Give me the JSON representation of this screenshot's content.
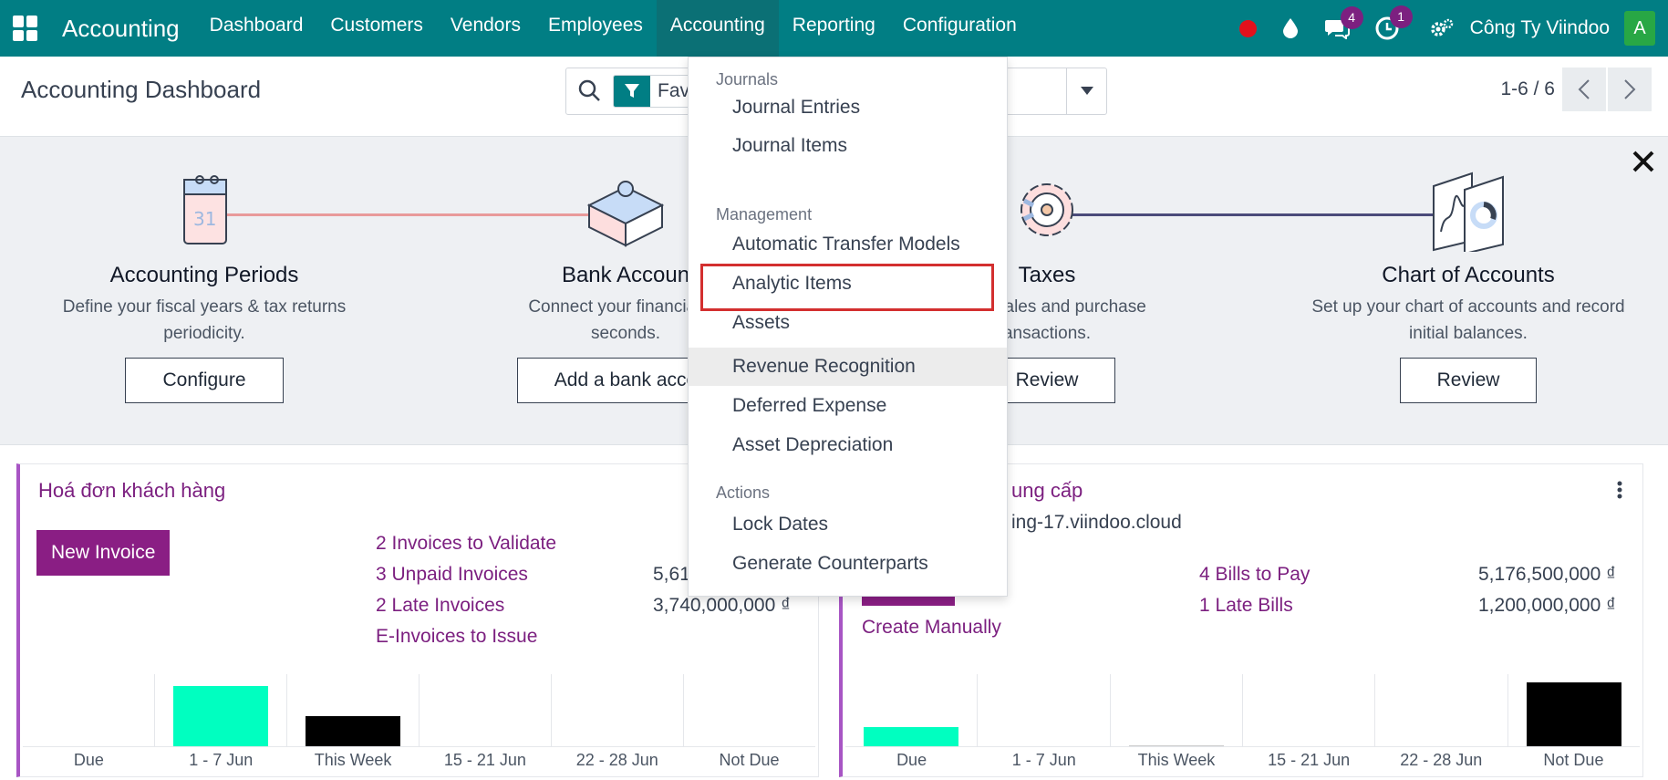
{
  "navbar": {
    "brand": "Accounting",
    "menu": [
      "Dashboard",
      "Customers",
      "Vendors",
      "Employees",
      "Accounting",
      "Reporting",
      "Configuration"
    ],
    "messages_count": "4",
    "activities_count": "1",
    "company": "Công Ty Viindoo",
    "avatar_letter": "A"
  },
  "control_panel": {
    "title": "Accounting Dashboard",
    "facet_label": "Fav",
    "pager": "1-6 / 6"
  },
  "onboarding": {
    "steps": [
      {
        "title": "Accounting Periods",
        "desc1": "Define your fiscal years & tax returns",
        "desc2": "periodicity.",
        "button": "Configure"
      },
      {
        "title": "Bank Accoun",
        "desc1": "Connect your financial ac",
        "desc2": "seconds.",
        "button": "Add a bank acco"
      },
      {
        "title": "Taxes",
        "desc1": "es for sales and purchase",
        "desc2": "ansactions.",
        "button": "Review"
      },
      {
        "title": "Chart of Accounts",
        "desc1": "Set up your chart of accounts and record",
        "desc2": "initial balances.",
        "button": "Review"
      }
    ]
  },
  "sales_card": {
    "title": "Hoá đơn khách hàng",
    "new_button": "New Invoice",
    "links": [
      "2 Invoices to Validate",
      "3 Unpaid Invoices",
      "2 Late Invoices",
      "E-Invoices to Issue"
    ],
    "amounts": [
      "5,61",
      "3,740,000,000 ₫"
    ],
    "graph_labels": [
      "Due",
      "1 - 7 Jun",
      "This Week",
      "15 - 21 Jun",
      "22 - 28 Jun",
      "Not Due"
    ],
    "graph_values": [
      0,
      0.82,
      0.41,
      0,
      0,
      0
    ],
    "graph_colors": [
      "#00ffc0",
      "#00ffc0",
      "#000000",
      "#000000",
      "#000000",
      "#000000"
    ]
  },
  "purchase_card": {
    "title": "ung cấp",
    "subtitle": "ing-17.viindoo.cloud",
    "create_link": "Create Manually",
    "links": [
      "4 Bills to Pay",
      "1 Late Bills"
    ],
    "amounts": [
      "5,176,500,000 ₫",
      "1,200,000,000 ₫"
    ],
    "graph_labels": [
      "Due",
      "1 - 7 Jun",
      "This Week",
      "15 - 21 Jun",
      "22 - 28 Jun",
      "Not Due"
    ],
    "graph_values": [
      0.26,
      0,
      0.01,
      0,
      0,
      0.87
    ],
    "graph_colors": [
      "#00ffc0",
      "#00ffc0",
      "#cccccc",
      "#000000",
      "#000000",
      "#000000"
    ]
  },
  "dropdown": {
    "headers": [
      "Journals",
      "Management",
      "Actions"
    ],
    "items": [
      "Journal Entries",
      "Journal Items",
      "Automatic Transfer Models",
      "Analytic Items",
      "Assets",
      "Revenue Recognition",
      "Deferred Expense",
      "Asset Depreciation",
      "Lock Dates",
      "Generate Counterparts"
    ]
  }
}
